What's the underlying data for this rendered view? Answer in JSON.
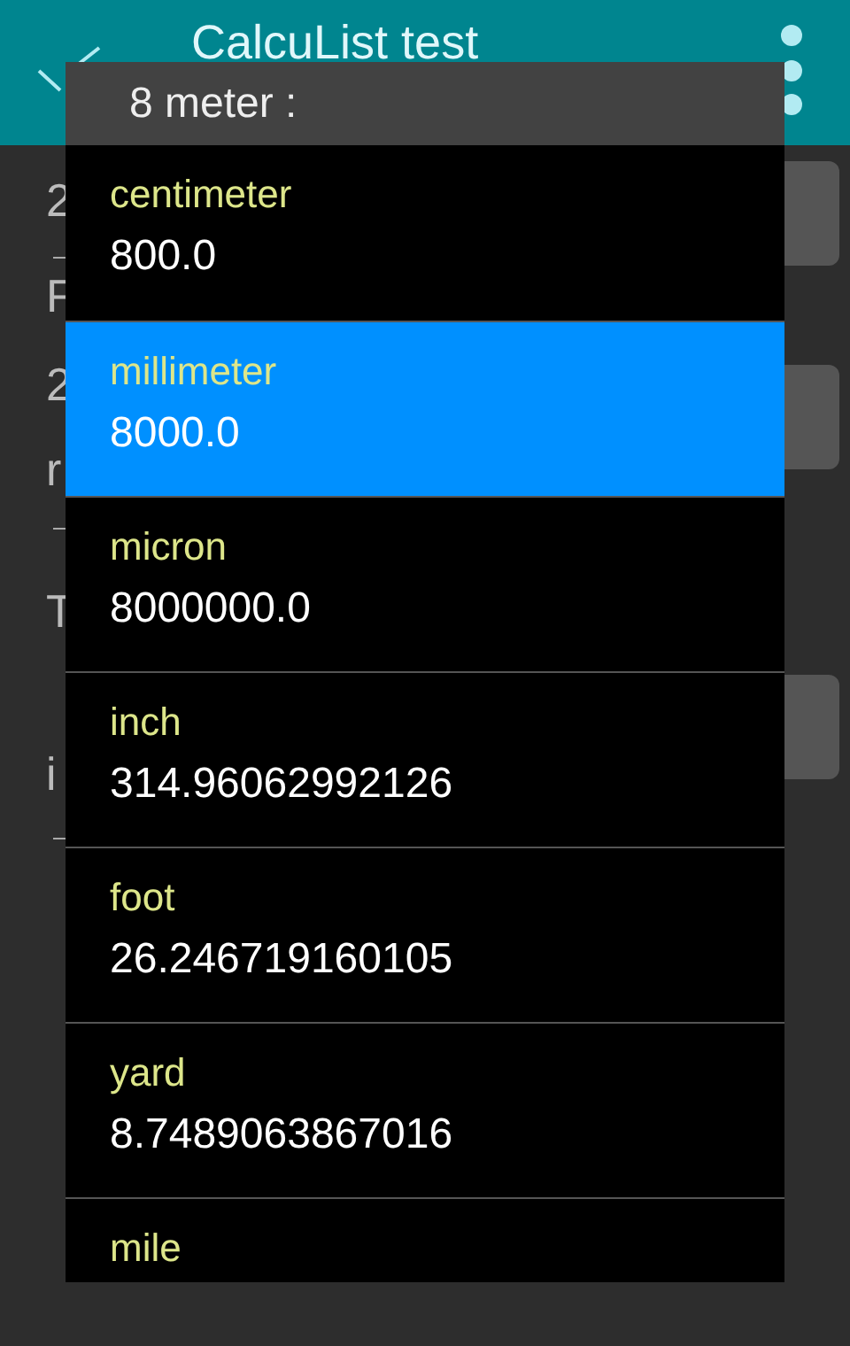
{
  "app_bar": {
    "title": "CalcuList test"
  },
  "background_fragments": [
    {
      "text": "2"
    },
    {
      "text": "F"
    },
    {
      "text": "2"
    },
    {
      "text": "r"
    },
    {
      "text": "T"
    },
    {
      "text": "i"
    }
  ],
  "dialog": {
    "title": "8 meter :",
    "items": [
      {
        "label": "centimeter",
        "value": "800.0",
        "selected": false
      },
      {
        "label": "millimeter",
        "value": "8000.0",
        "selected": true
      },
      {
        "label": "micron",
        "value": "8000000.0",
        "selected": false
      },
      {
        "label": "inch",
        "value": "314.96062992126",
        "selected": false
      },
      {
        "label": "foot",
        "value": "26.246719160105",
        "selected": false
      },
      {
        "label": "yard",
        "value": "8.7489063867016",
        "selected": false
      },
      {
        "label": "mile",
        "selected": false
      }
    ]
  }
}
